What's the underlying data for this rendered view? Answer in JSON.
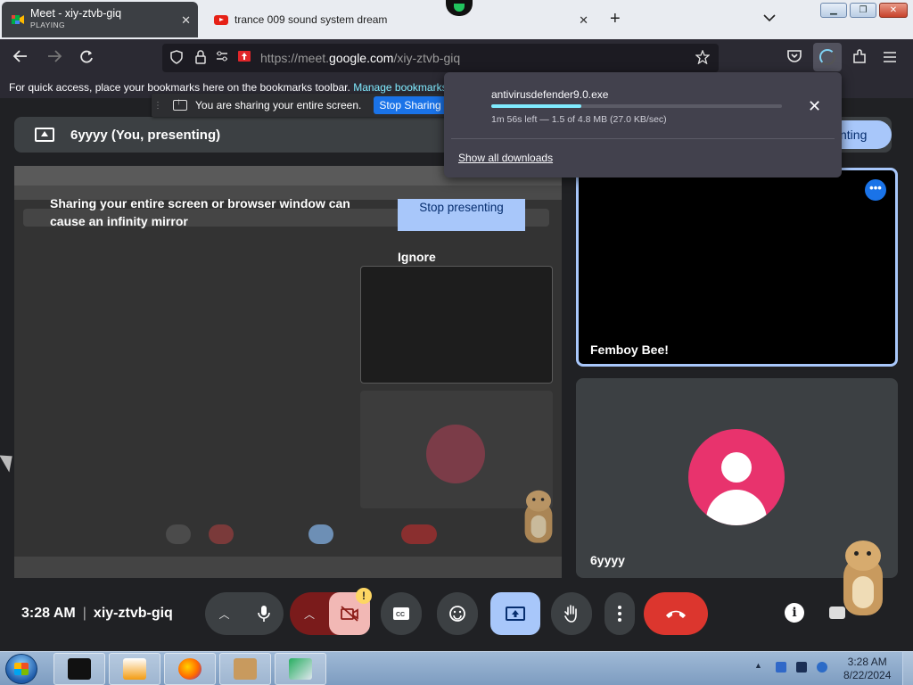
{
  "browser": {
    "tabs": [
      {
        "title": "Meet - xiy-ztvb-giq",
        "subtitle": "PLAYING"
      },
      {
        "title": "trance 009 sound system dream"
      }
    ],
    "url_prefix": "https://meet.",
    "url_domain": "google.com",
    "url_suffix": "/xiy-ztvb-giq",
    "bookmarks_hint": "For quick access, place your bookmarks here on the bookmarks toolbar.",
    "bookmarks_link": "Manage bookmarks"
  },
  "downloads": {
    "file": "antivirusdefender9.0.exe",
    "progress": 0.31,
    "status": "1m 56s left — 1.5 of 4.8 MB (27.0 KB/sec)",
    "show_all": "Show all downloads"
  },
  "sharing_bar": {
    "message": "You are sharing your entire screen.",
    "stop_label": "Stop Sharing"
  },
  "meet": {
    "presenting_label": "6yyyy (You, presenting)",
    "presenting_button": "nting",
    "infinity_warning": "Sharing your entire screen or browser window can cause an infinity mirror",
    "stop_presenting": "Stop presenting",
    "ignore": "Ignore",
    "participants": [
      {
        "name": "Femboy Bee!"
      },
      {
        "name": "6yyyy"
      }
    ],
    "time": "3:28 AM",
    "meeting_code": "xiy-ztvb-giq",
    "controls": [
      "mic",
      "camera-off",
      "captions",
      "emoji",
      "present",
      "raise-hand",
      "more",
      "end-call"
    ],
    "warning_badge": "!"
  },
  "taskbar": {
    "clock_time": "3:28 AM",
    "clock_date": "8/22/2024"
  },
  "colors": {
    "meet_bg": "#202124",
    "accent_blue": "#a8c7fa",
    "end_call_red": "#dc362e",
    "avatar_pink": "#e8336d"
  }
}
